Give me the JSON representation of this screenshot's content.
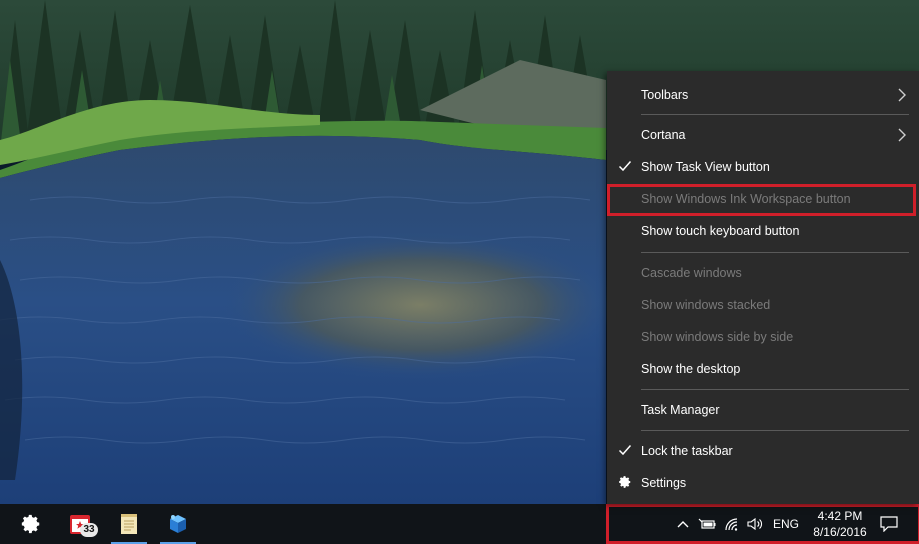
{
  "context_menu": {
    "toolbars": "Toolbars",
    "cortana": "Cortana",
    "show_task_view": "Show Task View button",
    "show_ink_workspace": "Show Windows Ink Workspace button",
    "show_touch_keyboard": "Show touch keyboard button",
    "cascade": "Cascade windows",
    "stacked": "Show windows stacked",
    "side_by_side": "Show windows side by side",
    "show_desktop": "Show the desktop",
    "task_manager": "Task Manager",
    "lock_taskbar": "Lock the taskbar",
    "settings": "Settings"
  },
  "taskbar": {
    "pinned_icons": [
      "gear-icon",
      "calendar-app-icon",
      "notepad-icon",
      "cube-app-icon"
    ],
    "calendar_badge": "33",
    "tray": {
      "language": "ENG",
      "time": "4:42 PM",
      "date": "8/16/2016"
    }
  },
  "colors": {
    "menu_bg": "#2b2b2b",
    "taskbar_bg": "#101418",
    "highlight": "#d01f2a",
    "disabled_text": "#7b7b7b"
  }
}
